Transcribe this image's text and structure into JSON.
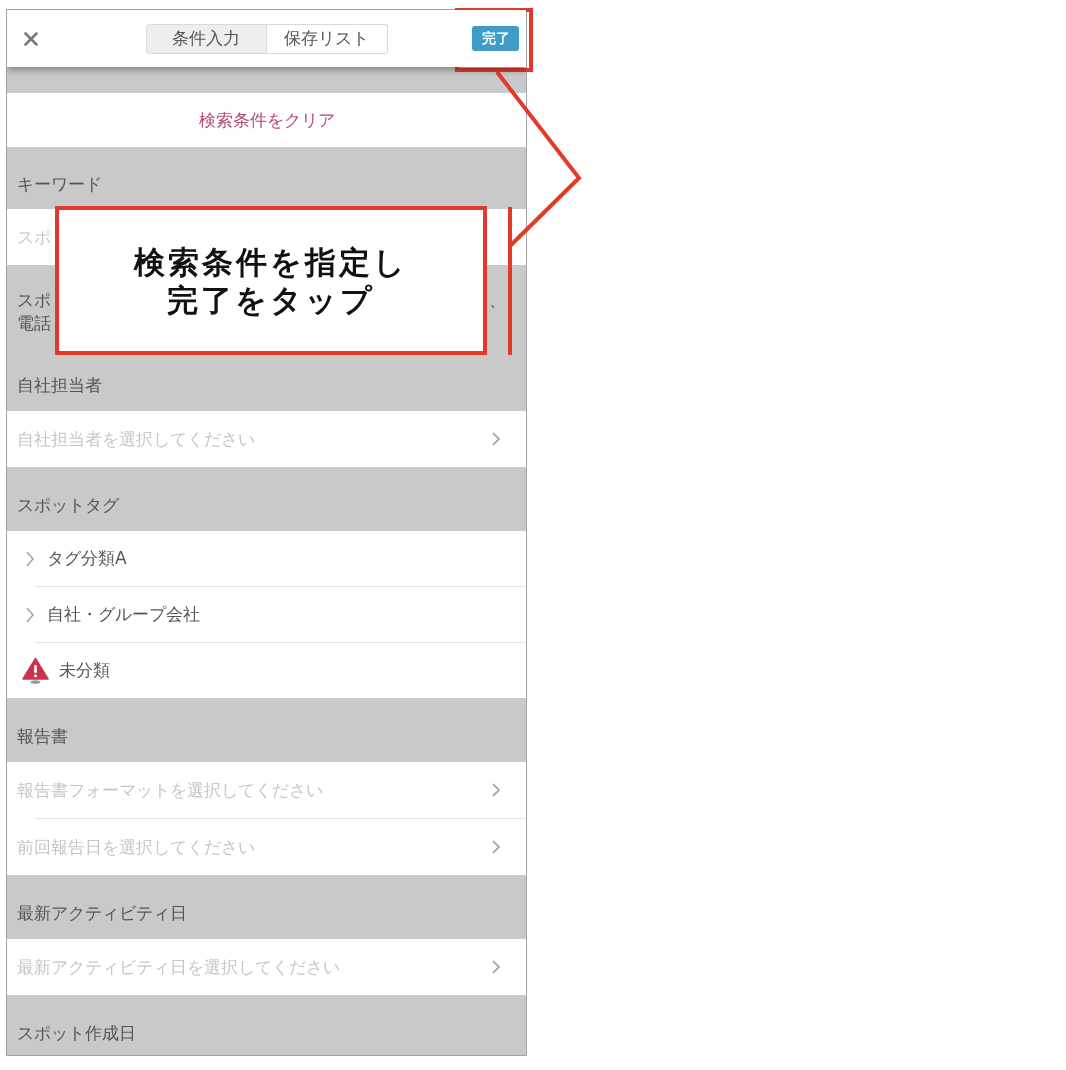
{
  "top_bar": {
    "tabs": [
      {
        "label": "条件入力",
        "selected": true
      },
      {
        "label": "保存リスト",
        "selected": false
      }
    ],
    "done_button": "完了"
  },
  "clear_button": "検索条件をクリア",
  "sections": [
    {
      "title": "キーワード",
      "rows": [
        {
          "kind": "input",
          "placeholder": "スポ"
        }
      ],
      "note": {
        "lines": [
          "スポ",
          "電話"
        ],
        "trailing": "、"
      }
    },
    {
      "title": "自社担当者",
      "rows": [
        {
          "kind": "select",
          "placeholder": "自社担当者を選択してください"
        }
      ]
    },
    {
      "title": "スポットタグ",
      "rows": [
        {
          "kind": "group",
          "label": "タグ分類A"
        },
        {
          "kind": "group",
          "label": "自社・グループ会社"
        },
        {
          "kind": "warning",
          "label": "未分類"
        }
      ]
    },
    {
      "title": "報告書",
      "rows": [
        {
          "kind": "select",
          "placeholder": "報告書フォーマットを選択してください"
        },
        {
          "kind": "select",
          "placeholder": "前回報告日を選択してください"
        }
      ]
    },
    {
      "title": "最新アクティビティ日",
      "rows": [
        {
          "kind": "select",
          "placeholder": "最新アクティビティ日を選択してください"
        }
      ]
    },
    {
      "title": "スポット作成日"
    }
  ],
  "callout": {
    "lines": [
      "検索条件を指定し",
      "完了をタップ"
    ]
  }
}
